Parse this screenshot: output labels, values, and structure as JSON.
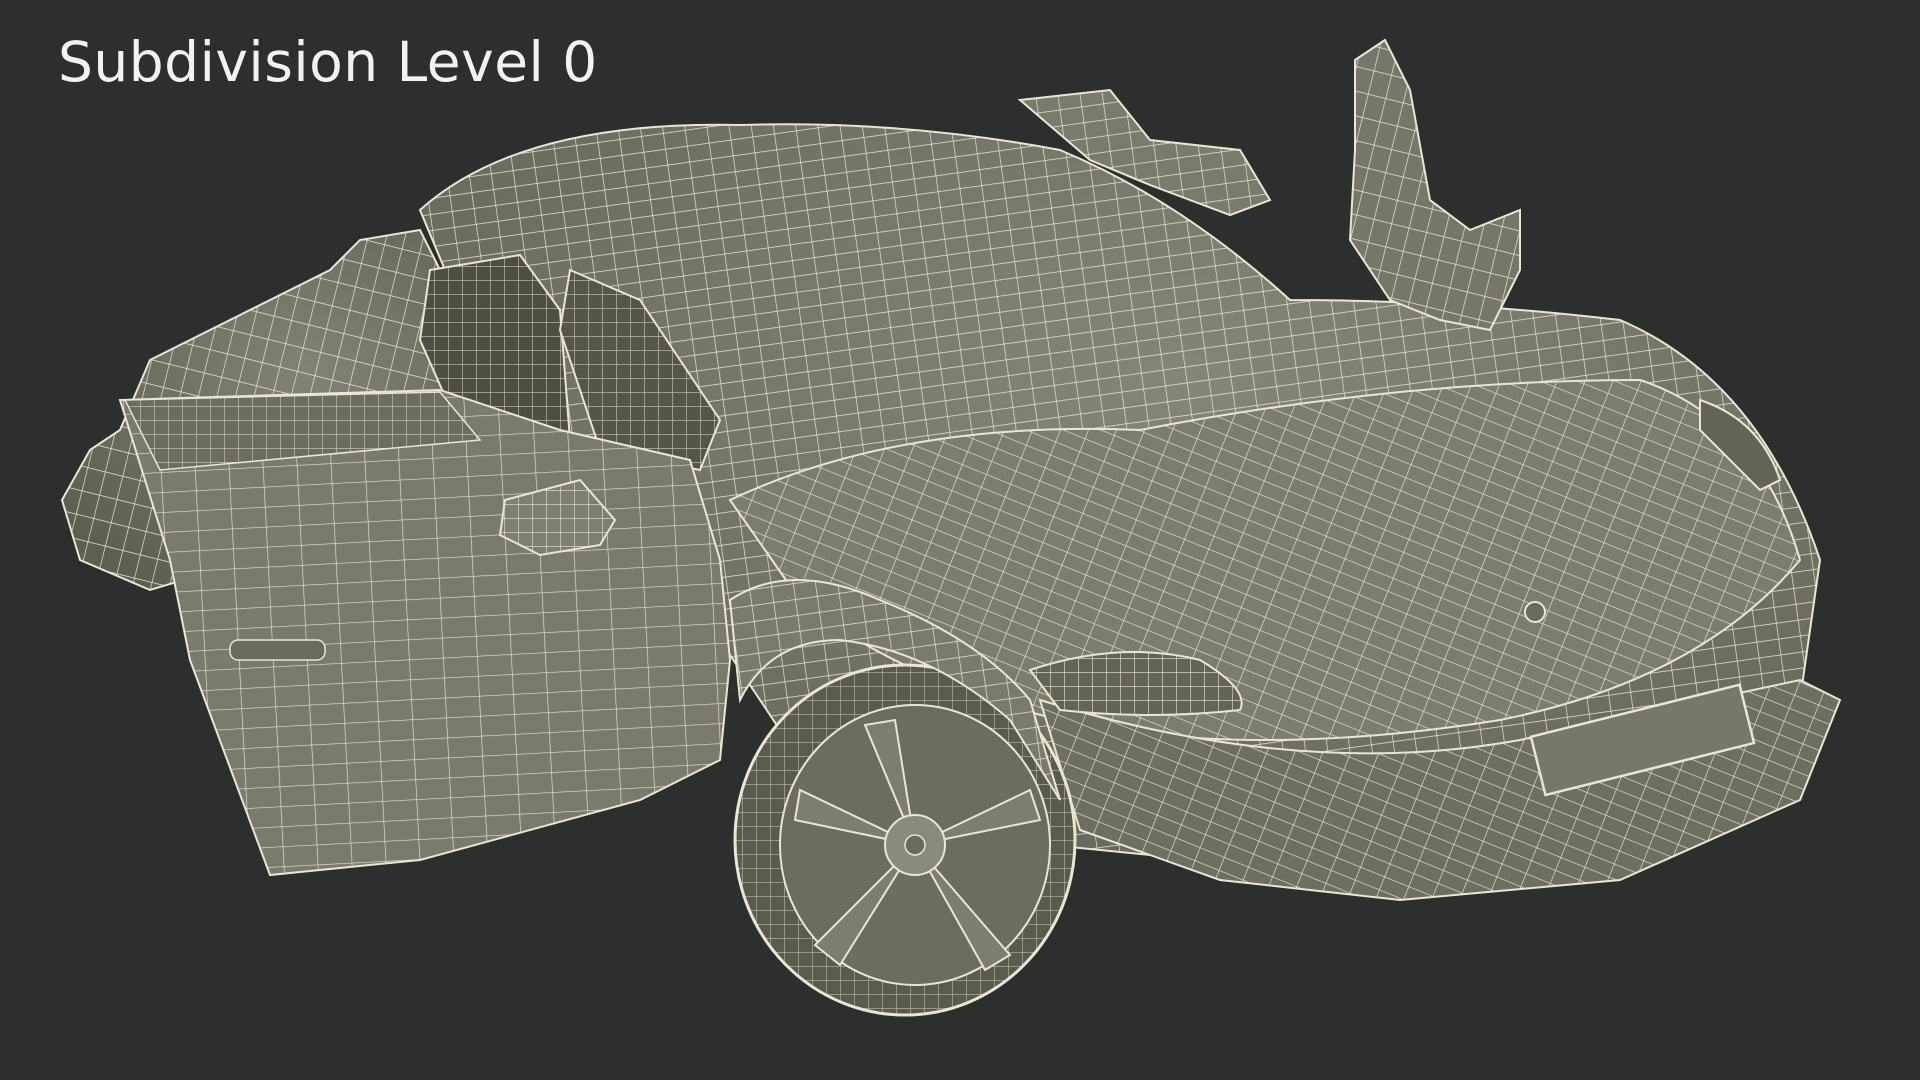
{
  "caption": "Subdivision Level 0",
  "model": {
    "subject": "sports car wireframe with doors open",
    "mesh_fill": "#77776a",
    "mesh_shade": "#5b5b50",
    "wire_color": "#e9e6d2",
    "background": "#2e2e2e"
  }
}
